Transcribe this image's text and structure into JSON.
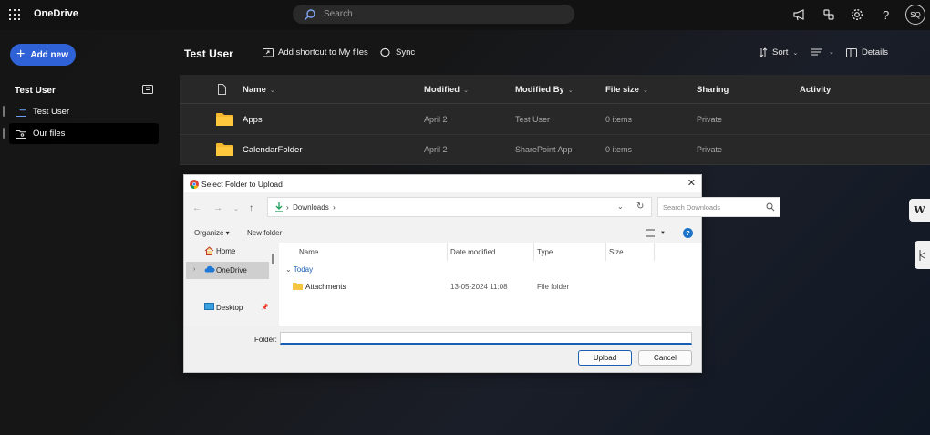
{
  "app": {
    "name": "OneDrive"
  },
  "search": {
    "placeholder": "Search"
  },
  "user": {
    "initials": "SQ"
  },
  "left": {
    "add_new": "Add new",
    "section_title": "Test User",
    "items": [
      {
        "label": "Test User",
        "icon": "folder-icon"
      },
      {
        "label": "Our files",
        "icon": "shared-folder-icon"
      }
    ]
  },
  "header": {
    "title": "Test User",
    "add_shortcut": "Add shortcut to My files",
    "sync": "Sync",
    "sort": "Sort",
    "details": "Details"
  },
  "table": {
    "columns": [
      "Name",
      "Modified",
      "Modified By",
      "File size",
      "Sharing",
      "Activity"
    ],
    "rows": [
      {
        "name": "Apps",
        "modified": "April 2",
        "modified_by": "Test User",
        "size": "0 items",
        "sharing": "Private"
      },
      {
        "name": "CalendarFolder",
        "modified": "April 2",
        "modified_by": "SharePoint App",
        "size": "0 items",
        "sharing": "Private"
      }
    ]
  },
  "side_tabs": {
    "w_label": "W"
  },
  "dialog": {
    "title": "Select Folder to Upload",
    "breadcrumb": "Downloads",
    "search_placeholder": "Search Downloads",
    "organize": "Organize ▾",
    "new_folder": "New folder",
    "tree": [
      {
        "label": "Home"
      },
      {
        "label": "OneDrive"
      },
      {
        "label": "Desktop"
      }
    ],
    "columns": [
      "Name",
      "Date modified",
      "Type",
      "Size"
    ],
    "group": "Today",
    "files": [
      {
        "name": "Attachments",
        "date": "13-05-2024 11:08",
        "type": "File folder",
        "size": ""
      }
    ],
    "folder_label": "Folder:",
    "folder_value": "",
    "upload": "Upload",
    "cancel": "Cancel"
  },
  "colors": {
    "accent": "#2f62d6",
    "folder": "#f5b82e",
    "background": "#161616"
  }
}
